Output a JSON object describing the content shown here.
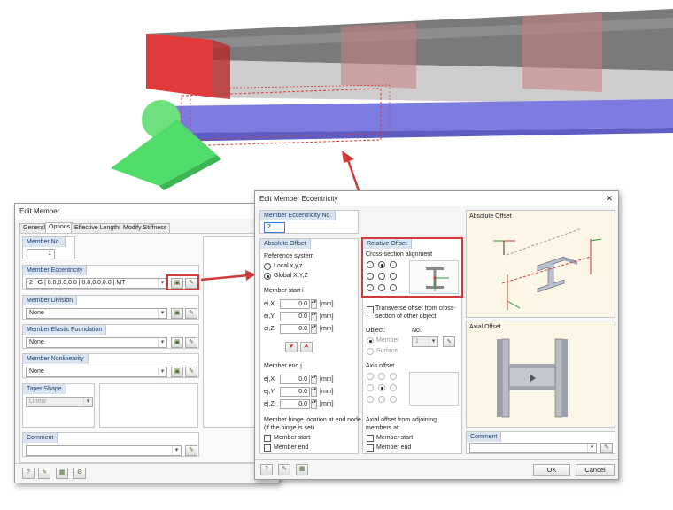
{
  "edit_member": {
    "title": "Edit Member",
    "tabs": [
      "General",
      "Options",
      "Effective Lengths",
      "Modify Stiffness"
    ],
    "member_no": {
      "label": "Member No.",
      "value": "1"
    },
    "member_eccentricity": {
      "label": "Member Eccentricity",
      "value": "2 | G | 0.0,0.0,0.0 | 0.0,0.0,0.0 | MT"
    },
    "member_division": {
      "label": "Member Division",
      "value": "None"
    },
    "elastic_foundation": {
      "label": "Member Elastic Foundation",
      "value": "None"
    },
    "nonlinearity": {
      "label": "Member Nonlinearity",
      "value": "None"
    },
    "taper_shape": {
      "label": "Taper Shape",
      "value": "Linear"
    },
    "comment": {
      "label": "Comment",
      "value": ""
    }
  },
  "eccentricity_dialog": {
    "title": "Edit Member Eccentricity",
    "close": "✕",
    "ecc_no": {
      "label": "Member Eccentricity No.",
      "value": "2"
    },
    "absolute_offset": {
      "header": "Absolute Offset",
      "ref_system": "Reference system",
      "local": "Local x,y,z",
      "global": "Global X,Y,Z",
      "start_label": "Member start i",
      "end_label": "Member end j",
      "start": [
        {
          "name": "ei,X",
          "value": "0.0",
          "unit": "[mm]"
        },
        {
          "name": "ei,Y",
          "value": "0.0",
          "unit": "[mm]"
        },
        {
          "name": "ei,Z",
          "value": "0.0",
          "unit": "[mm]"
        }
      ],
      "end": [
        {
          "name": "ej,X",
          "value": "0.0",
          "unit": "[mm]"
        },
        {
          "name": "ej,Y",
          "value": "0.0",
          "unit": "[mm]"
        },
        {
          "name": "ej,Z",
          "value": "0.0",
          "unit": "[mm]"
        }
      ],
      "hinge_label_1": "Member hinge location at end node",
      "hinge_label_2": "(if the hinge is set)",
      "hinge_start": "Member start",
      "hinge_end": "Member end"
    },
    "relative_offset": {
      "header": "Relative Offset",
      "cs_alignment": "Cross-section alignment",
      "transverse_1": "Transverse offset from cross-",
      "transverse_2": "section of other object",
      "object_label": "Object:",
      "no_label": "No.",
      "object_member": "Member",
      "object_surface": "Surface",
      "no_value": "1",
      "axis_offset": "Axis offset",
      "axial_label_1": "Axial offset from adjoining",
      "axial_label_2": "members at:",
      "axial_start": "Member start",
      "axial_end": "Member end"
    },
    "absolute_offset_preview": "Absolute Offset",
    "axial_offset_preview": "Axial Offset",
    "comment_label": "Comment",
    "ok": "OK",
    "cancel": "Cancel"
  },
  "colors": {
    "accent_header": "#dbe5f1",
    "highlight_red": "#d23a3a",
    "beam_gray": "#8a8a8a",
    "beam_blue": "#7b7be0",
    "support_green": "#4fdc6a"
  }
}
